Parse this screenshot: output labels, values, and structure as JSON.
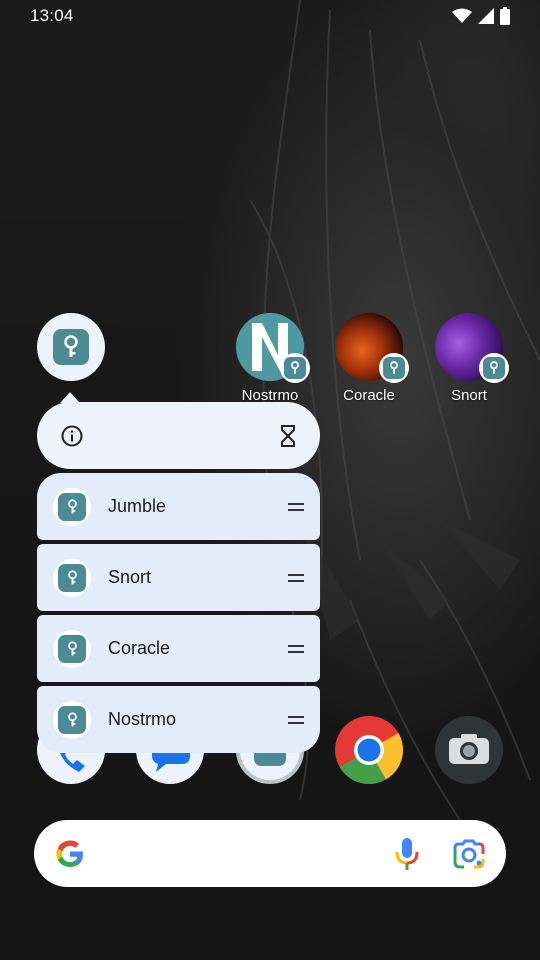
{
  "status_bar": {
    "time": "13:04",
    "icons": [
      "wifi-icon",
      "cellular-icon",
      "battery-icon"
    ]
  },
  "apps": {
    "nostrmo": {
      "label": "Nostrmo"
    },
    "coracle": {
      "label": "Coracle"
    },
    "snort": {
      "label": "Snort"
    }
  },
  "popup": {
    "actions": [
      "info-icon",
      "hourglass-icon"
    ],
    "shortcuts": [
      {
        "label": "Jumble"
      },
      {
        "label": "Snort"
      },
      {
        "label": "Coracle"
      },
      {
        "label": "Nostrmo"
      }
    ]
  },
  "dock": [
    "phone-icon",
    "messages-icon",
    "vault-app-icon",
    "chrome-icon",
    "camera-icon"
  ],
  "search_bar": {
    "icons": [
      "google-logo",
      "microphone-icon",
      "lens-icon"
    ]
  },
  "colors": {
    "vault_teal": "#4d8b94",
    "popup_bg": "#eef2fb",
    "shortcut_bg": "#e3ecfb"
  }
}
